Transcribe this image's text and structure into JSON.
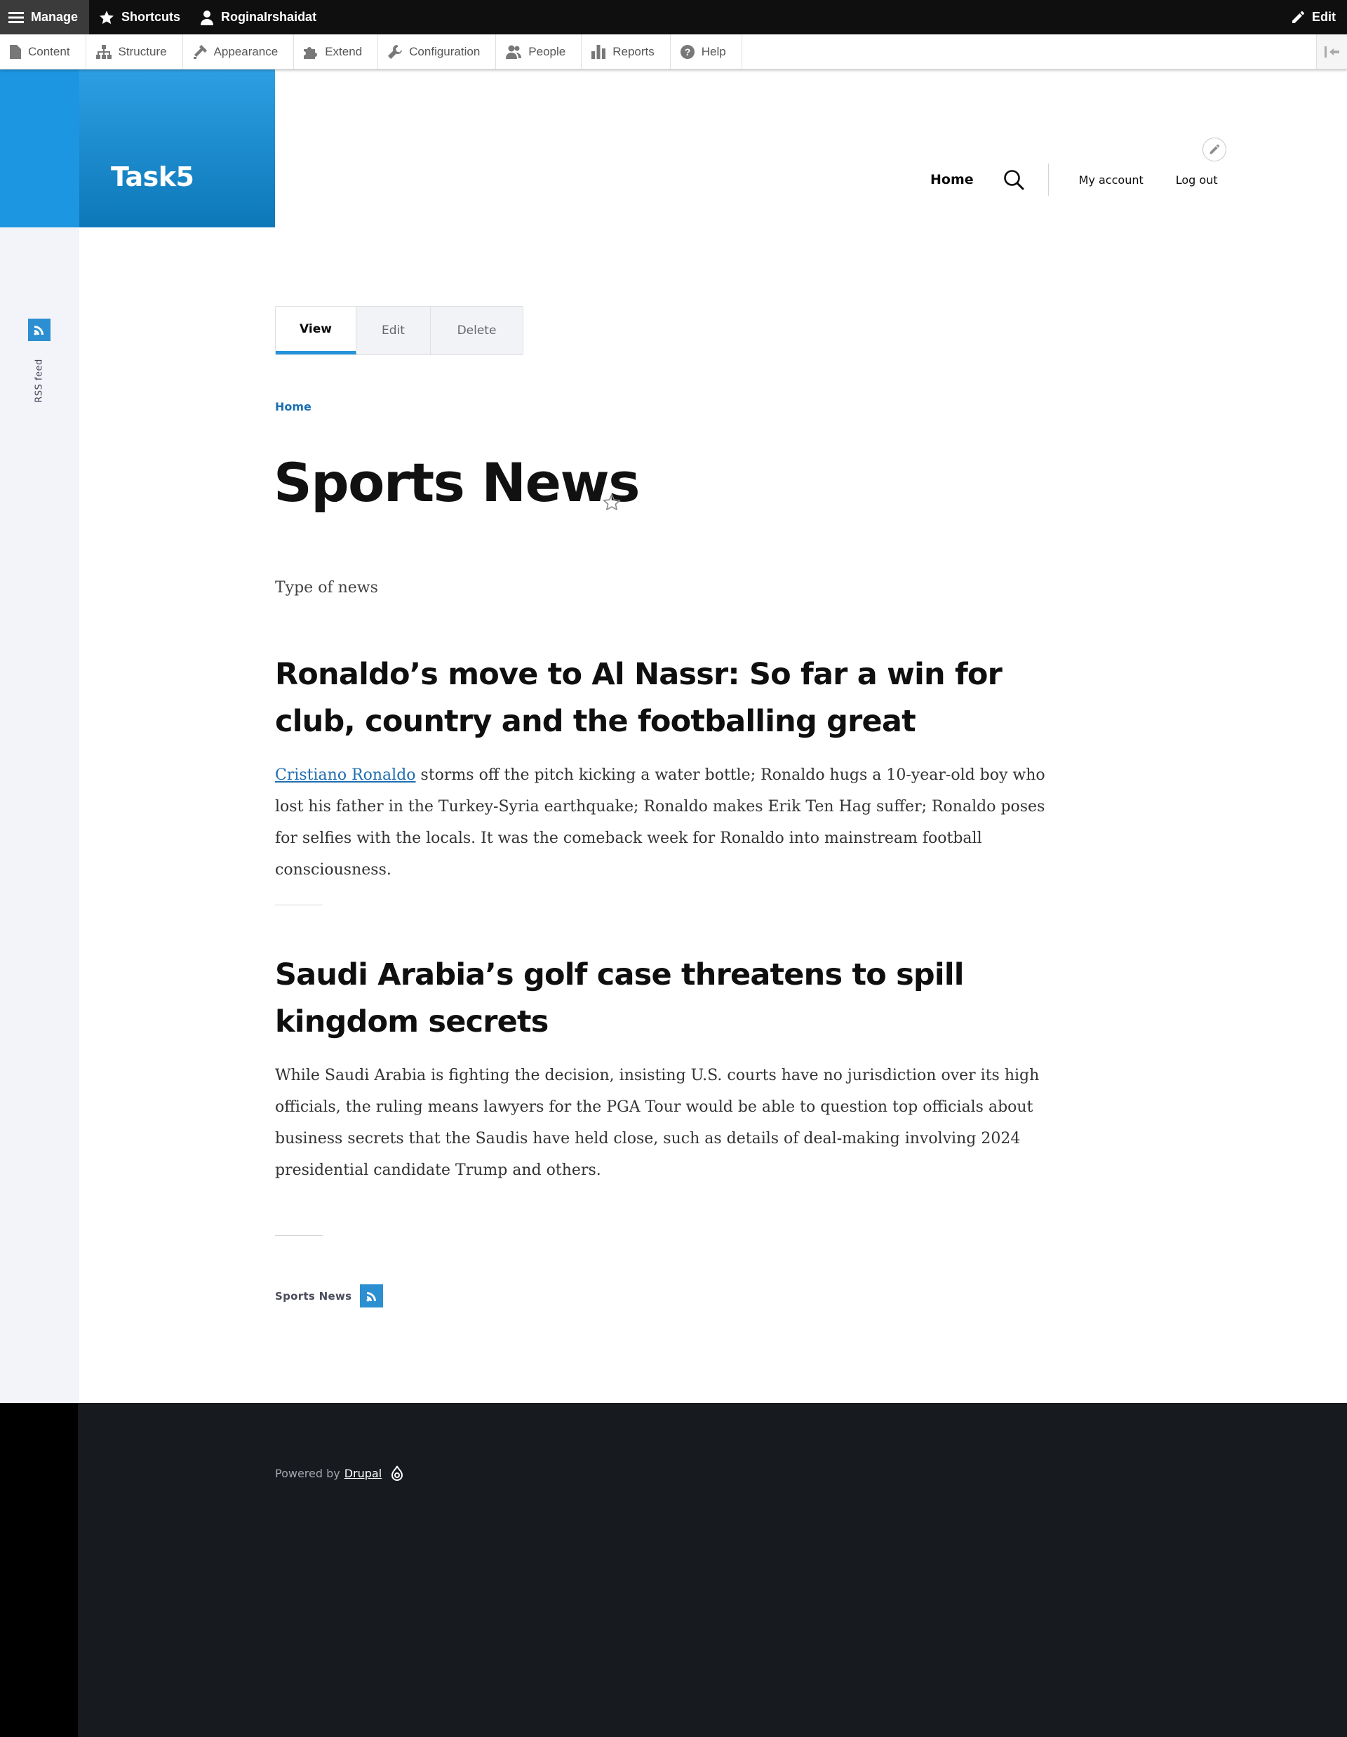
{
  "toolbar": {
    "manage": "Manage",
    "shortcuts": "Shortcuts",
    "user": "RoginaIrshaidat",
    "edit": "Edit"
  },
  "tray": {
    "items": [
      {
        "label": "Content",
        "icon": "document-icon"
      },
      {
        "label": "Structure",
        "icon": "sitemap-icon"
      },
      {
        "label": "Appearance",
        "icon": "brush-icon"
      },
      {
        "label": "Extend",
        "icon": "puzzle-icon"
      },
      {
        "label": "Configuration",
        "icon": "wrench-icon"
      },
      {
        "label": "People",
        "icon": "people-icon"
      },
      {
        "label": "Reports",
        "icon": "bar-chart-icon"
      },
      {
        "label": "Help",
        "icon": "help-icon"
      }
    ]
  },
  "site": {
    "name": "Task5"
  },
  "nav": {
    "home": "Home",
    "my_account": "My account",
    "log_out": "Log out"
  },
  "rss_side_label": "RSS feed",
  "tabs": {
    "view": "View",
    "edit": "Edit",
    "delete": "Delete"
  },
  "breadcrumb": "Home",
  "page": {
    "title": "Sports News",
    "description": "Type of news"
  },
  "articles": [
    {
      "title": "Ronaldo’s move to Al Nassr: So far a win for club, country and the footballing great",
      "link_text": "Cristiano Ronaldo",
      "body": " storms off the pitch kicking a water bottle; Ronaldo hugs a 10-year-old boy who lost his father in the Turkey-Syria earthquake; Ronaldo makes Erik Ten Hag suffer; Ronaldo poses for selfies with the locals. It was the comeback week for Ronaldo into mainstream football consciousness."
    },
    {
      "title": "Saudi Arabia’s golf case threatens to spill kingdom secrets",
      "body": "While Saudi Arabia is fighting the decision, insisting U.S. courts have no jurisdiction over its high officials, the ruling means lawyers for the PGA Tour would be able to question top officials about business secrets that the Saudis have held close, such as details of deal-making involving 2024 presidential candidate Trump and others."
    }
  ],
  "feed_footer_label": "Sports News",
  "footer": {
    "powered_by": "Powered by",
    "drupal": "Drupal"
  },
  "colors": {
    "accent": "#2494db",
    "link": "#1e6db0",
    "toolbar_bg": "#0f0f0f",
    "footer_bg": "#171a1f"
  }
}
